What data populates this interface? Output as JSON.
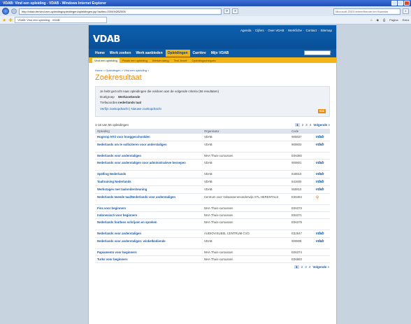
{
  "browser": {
    "window_title": "VDAB: Vind een opleiding - VDAB - Windows Internet Explorer",
    "url": "http://vdab.be/vind-een-opleiding/opleidingen/opleidingen.jsp?acties=2004%2B2006",
    "search_placeholder": "Live Search",
    "search_value": "Microsoft 2003 beheerfhende het Kwamier",
    "tab_title": "VDAB: Vind een opleiding - VDAB",
    "tools": [
      "Pagina",
      "Extra"
    ]
  },
  "site": {
    "top_links": [
      "Agenda",
      "Cijfers",
      "Over VDAB",
      "Werkfiche",
      "Contact",
      "Sitemap"
    ],
    "logo": "VDAB",
    "main_nav": [
      "Home",
      "Werk zoeken",
      "Werk aanbieden",
      "Opleidingen",
      "Carrière",
      "Mijn VDAB"
    ],
    "active_main": 3,
    "sub_nav": [
      "Vind een opleiding",
      "Plaats een opleiding",
      "Werkervaring",
      "Test Jezelf",
      "Opleidingscheques"
    ],
    "active_sub": 0,
    "breadcrumb": "Home > Opleidingen > Vind een opleiding >",
    "heading": "Zoekresultaat",
    "criteria": {
      "intro": "Je hebt gezocht naar opleidingen die voldoen aan de volgende criteria (56 resultaten)",
      "doelgroep_label": "Doelgroep",
      "doelgroep_value": "Werkzoekende",
      "trefwoorden_label": "Trefwoorden",
      "trefwoorden_value": "nederlands taal",
      "change_link": "Verfijn zoekopdracht | Nieuwe zoekopdracht",
      "rss": "RSS"
    },
    "results_count": "1-15 van 56 opleidingen",
    "pager": {
      "pages": [
        "1",
        "2",
        "3",
        "4"
      ],
      "current": "1",
      "next": "Volgende »"
    },
    "table_headers": [
      "Opleiding",
      "Organisator",
      "Code"
    ],
    "rows": [
      {
        "title": "Hogerop NT2 voor hooggeschoolden",
        "org": "VDAB",
        "code": "900837",
        "badge": "vdab"
      },
      {
        "title": "Nederlands om te solliciteren voor anderstaligen",
        "org": "VDAB",
        "code": "900803",
        "badge": "vdab"
      },
      {
        "title": "Nederlands voor anderstaligen",
        "org": "NHA Thuis-cursussen",
        "code": "E06380",
        "badge": ""
      },
      {
        "title": "Nederlands voor anderstaligen voor administratieve beroepen",
        "org": "VDAB",
        "code": "900801",
        "badge": "vdab"
      },
      {
        "title": "Spelling Nederlands",
        "org": "VDAB",
        "code": "640810",
        "badge": "vdab"
      },
      {
        "title": "Taaltraining Nederlands",
        "org": "VDAB",
        "code": "641600",
        "badge": "vdab"
      },
      {
        "title": "Werkstages met taalondersteuning",
        "org": "VDAB",
        "code": "550810",
        "badge": "vdab"
      },
      {
        "title": "Nederlands tweede taal/Nederlands voor anderstaligen",
        "org": "Centrum voor Volwassenenonderwijs STL HERENTALS",
        "code": "E36484",
        "badge": "pin"
      },
      {
        "title": "Fins voor beginners",
        "org": "NHA Thuis-cursussen",
        "code": "E06373",
        "badge": ""
      },
      {
        "title": "Indonesisch voor beginners",
        "org": "NHA Thuis-cursussen",
        "code": "E06371",
        "badge": ""
      },
      {
        "title": "Nederlands foutloos schrijven en spreken",
        "org": "NHA Thuis-cursussen",
        "code": "E06379",
        "badge": ""
      },
      {
        "title": "Nederlands voor anderstaligen",
        "org": "AUDIOVISUEEL CENTRUM CVO",
        "code": "E32547",
        "badge": "vdab"
      },
      {
        "title": "Nederlands voor anderstaligen: winkelbediende",
        "org": "VDAB",
        "code": "900808",
        "badge": "vdab"
      },
      {
        "title": "Papiamento voor beginners",
        "org": "NHA Thuis-cursussen",
        "code": "E06374",
        "badge": ""
      },
      {
        "title": "Turks voor beginners",
        "org": "NHA Thuis-cursussen",
        "code": "E06583",
        "badge": ""
      }
    ]
  }
}
